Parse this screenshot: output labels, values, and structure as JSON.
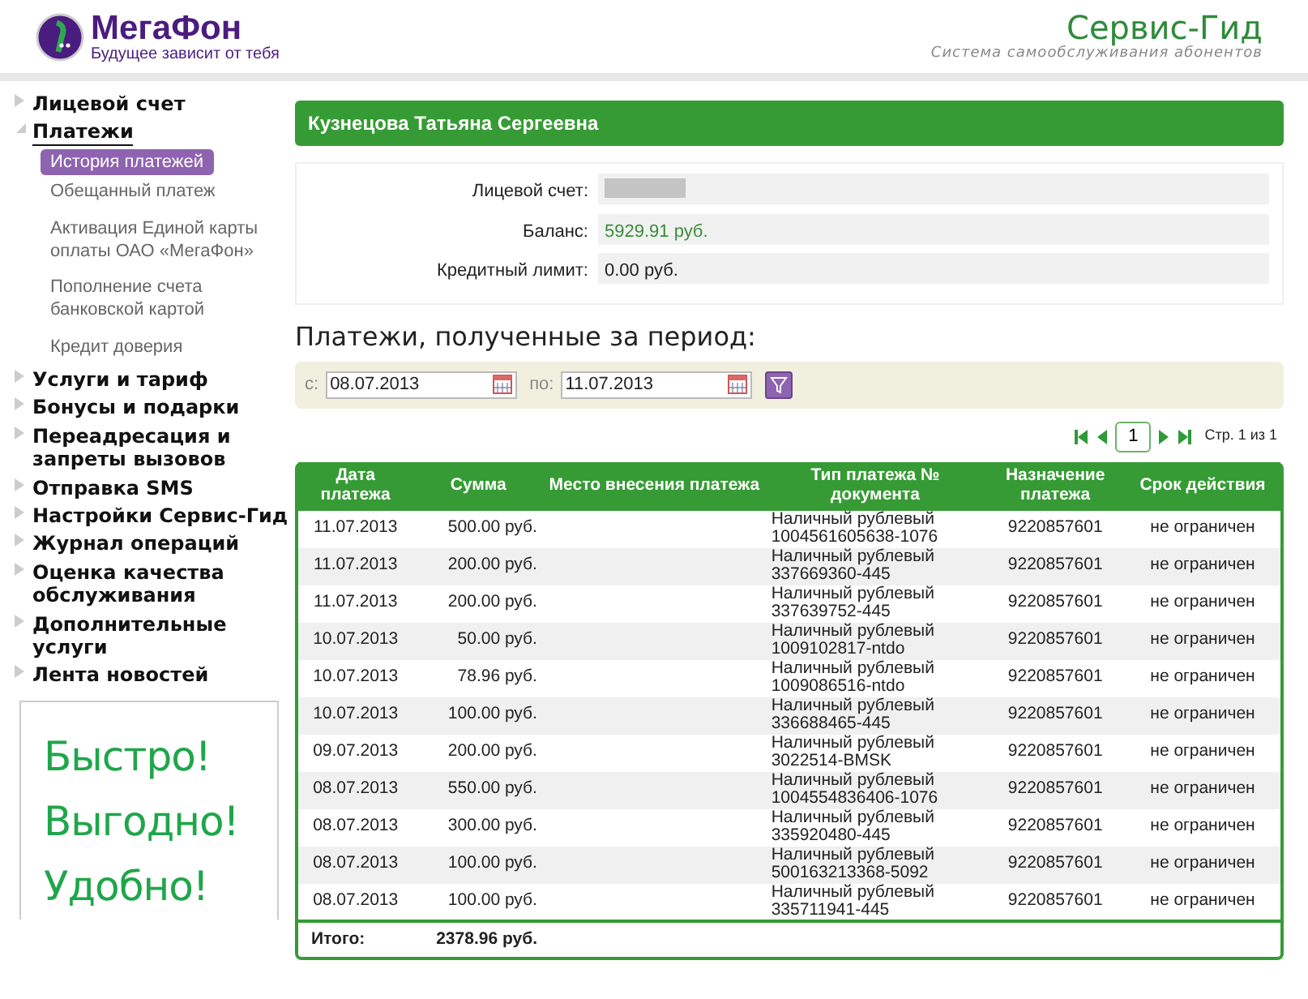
{
  "header": {
    "logo_text": "МегаФон",
    "logo_slogan": "Будущее зависит от тебя",
    "service_title": "Сервис-Гид",
    "service_subtitle": "Система самообслуживания абонентов"
  },
  "sidebar": {
    "items": [
      {
        "label": "Лицевой счет",
        "expanded": false,
        "selected": false
      },
      {
        "label": "Платежи",
        "expanded": true,
        "selected": true,
        "children": [
          {
            "label": "История платежей",
            "selected": true
          },
          {
            "label": "Обещанный платеж",
            "selected": false
          },
          {
            "label": "Активация Единой карты оплаты ОАО «МегаФон»",
            "selected": false
          },
          {
            "label": "Пополнение счета банковской картой",
            "selected": false
          },
          {
            "label": "Кредит доверия",
            "selected": false
          }
        ]
      },
      {
        "label": "Услуги и тариф",
        "expanded": false,
        "selected": false
      },
      {
        "label": "Бонусы и подарки",
        "expanded": false,
        "selected": false
      },
      {
        "label": "Переадресация и запреты вызовов",
        "expanded": false,
        "selected": false
      },
      {
        "label": "Отправка SMS",
        "expanded": false,
        "selected": false
      },
      {
        "label": "Настройки Сервис-Гид",
        "expanded": false,
        "selected": false
      },
      {
        "label": "Журнал операций",
        "expanded": false,
        "selected": false
      },
      {
        "label": "Оценка качества обслуживания",
        "expanded": false,
        "selected": false
      },
      {
        "label": "Дополнительные услуги",
        "expanded": false,
        "selected": false
      },
      {
        "label": "Лента новостей",
        "expanded": false,
        "selected": false
      }
    ],
    "promo": [
      "Быстро!",
      "Выгодно!",
      "Удобно!"
    ]
  },
  "subscriber": {
    "name": "Кузнецова Татьяна Сергеевна",
    "fields": [
      {
        "label": "Лицевой счет:",
        "redacted": true,
        "kind": "plain"
      },
      {
        "label": "Баланс:",
        "value": "5929.91 руб.",
        "redacted": false,
        "kind": "money"
      },
      {
        "label": "Кредитный лимит:",
        "value": "0.00 руб.",
        "redacted": false,
        "kind": "plain"
      }
    ]
  },
  "payments": {
    "heading": "Платежи, полученные за период:",
    "filter": {
      "from_label": "с:",
      "from": "08.07.2013",
      "to_label": "по:",
      "to": "11.07.2013"
    },
    "pager": {
      "page": "1",
      "info": "Стр. 1 из 1"
    },
    "table": {
      "columns": [
        "Дата платежа",
        "Сумма",
        "Место внесения платежа",
        "Тип платежа № документа",
        "Назначение платежа",
        "Срок действия"
      ],
      "rows": [
        [
          "11.07.2013",
          "500.00 руб.",
          "",
          "Наличный рублевый 1004561605638-1076",
          "9220857601",
          "не ограничен"
        ],
        [
          "11.07.2013",
          "200.00 руб.",
          "",
          "Наличный рублевый 337669360-445",
          "9220857601",
          "не ограничен"
        ],
        [
          "11.07.2013",
          "200.00 руб.",
          "",
          "Наличный рублевый 337639752-445",
          "9220857601",
          "не ограничен"
        ],
        [
          "10.07.2013",
          "50.00 руб.",
          "",
          "Наличный рублевый 1009102817-ntdo",
          "9220857601",
          "не ограничен"
        ],
        [
          "10.07.2013",
          "78.96 руб.",
          "",
          "Наличный рублевый 1009086516-ntdo",
          "9220857601",
          "не ограничен"
        ],
        [
          "10.07.2013",
          "100.00 руб.",
          "",
          "Наличный рублевый 336688465-445",
          "9220857601",
          "не ограничен"
        ],
        [
          "09.07.2013",
          "200.00 руб.",
          "",
          "Наличный рублевый 3022514-BMSK",
          "9220857601",
          "не ограничен"
        ],
        [
          "08.07.2013",
          "550.00 руб.",
          "",
          "Наличный рублевый 1004554836406-1076",
          "9220857601",
          "не ограничен"
        ],
        [
          "08.07.2013",
          "300.00 руб.",
          "",
          "Наличный рублевый 335920480-445",
          "9220857601",
          "не ограничен"
        ],
        [
          "08.07.2013",
          "100.00 руб.",
          "",
          "Наличный рублевый 500163213368-5092",
          "9220857601",
          "не ограничен"
        ],
        [
          "08.07.2013",
          "100.00 руб.",
          "",
          "Наличный рублевый 335711941-445",
          "9220857601",
          "не ограничен"
        ]
      ],
      "total_label": "Итого:",
      "total": "2378.96 руб."
    }
  }
}
